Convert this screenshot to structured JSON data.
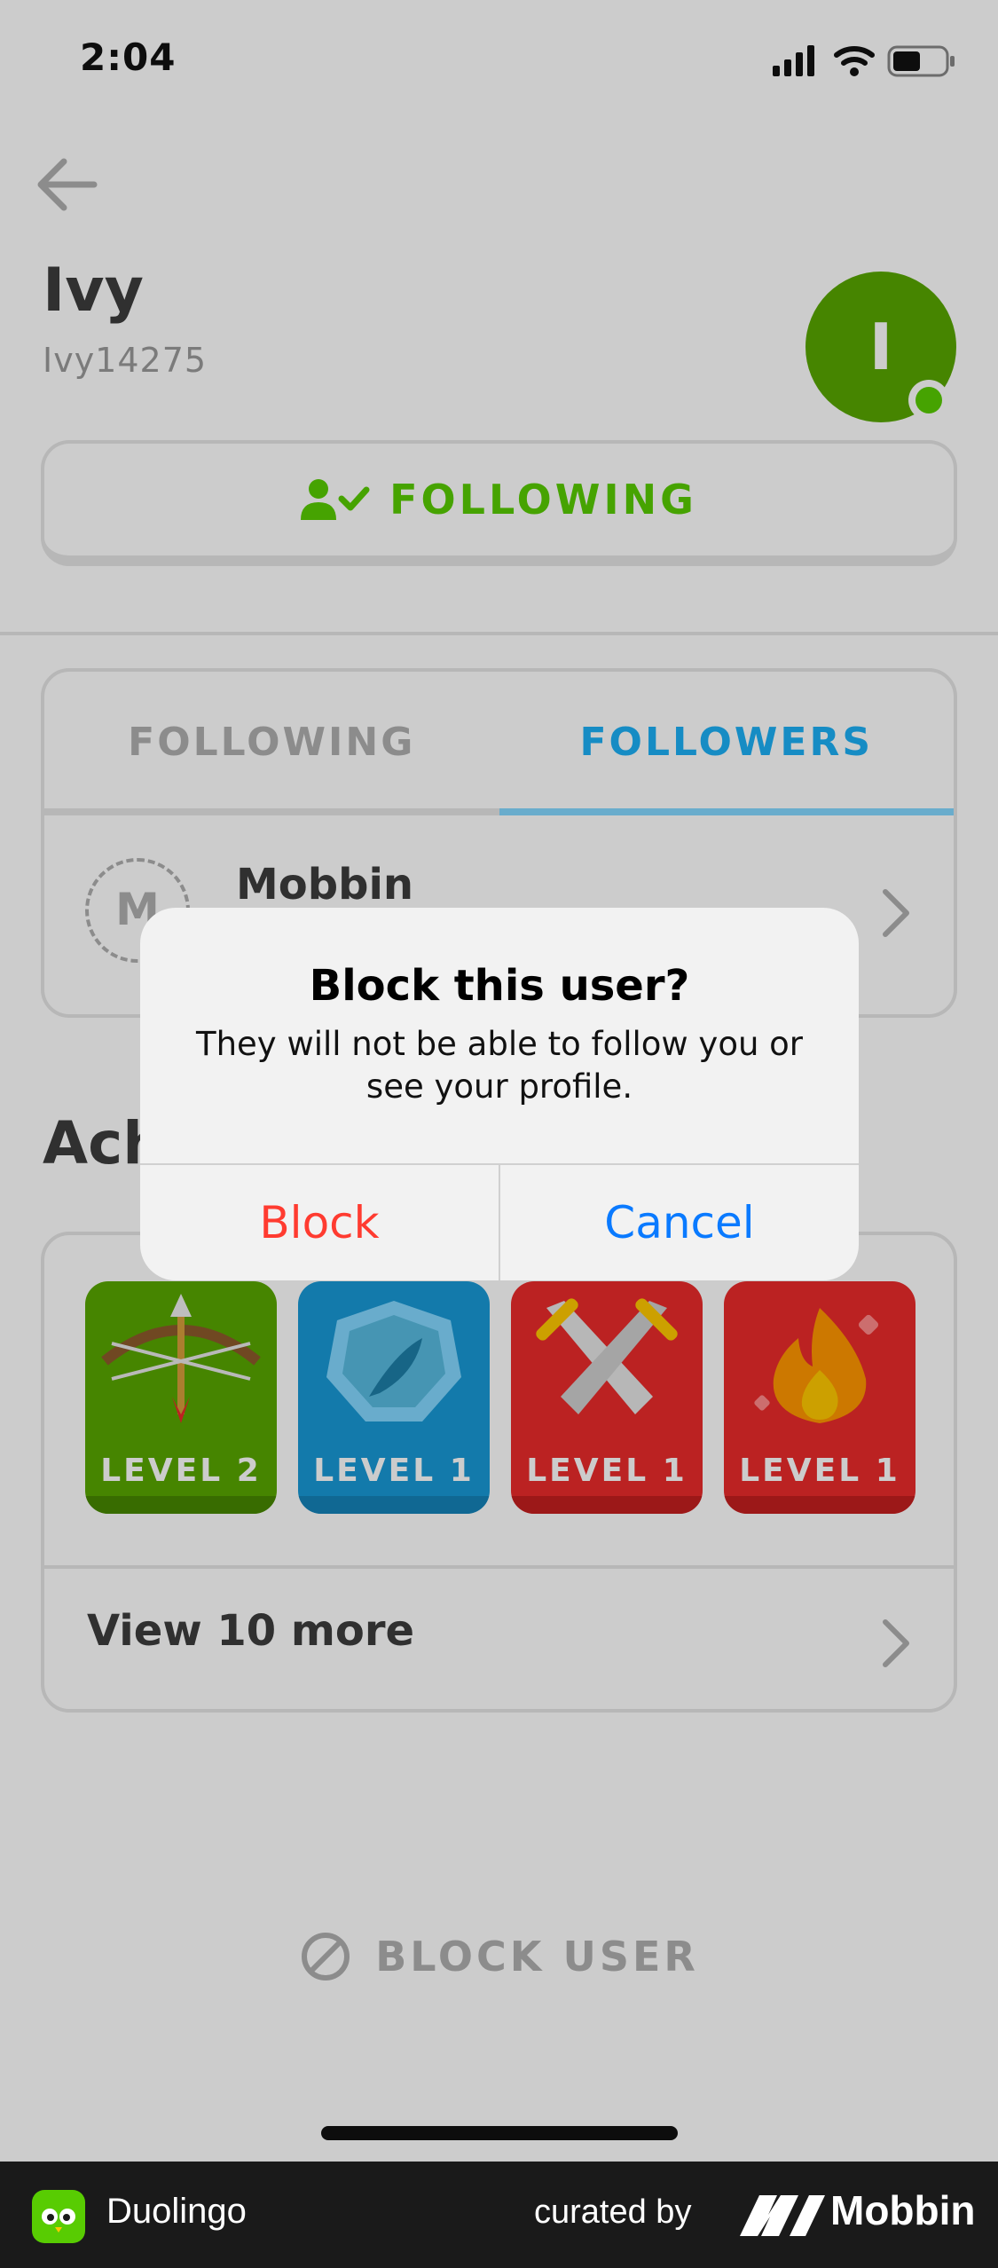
{
  "status_bar": {
    "time": "2:04"
  },
  "profile": {
    "name": "Ivy",
    "username": "Ivy14275",
    "avatar_letter": "I",
    "follow_button_label": "FOLLOWING"
  },
  "tabs": [
    {
      "label": "FOLLOWING",
      "active": false
    },
    {
      "label": "FOLLOWERS",
      "active": true
    }
  ],
  "followers": [
    {
      "avatar_letter": "M",
      "name": "Mobbin"
    }
  ],
  "achievements": {
    "title_visible": "Ach",
    "badges": [
      {
        "label": "LEVEL 2",
        "icon": "bow-arrow-icon",
        "color": "#58a700"
      },
      {
        "label": "LEVEL 1",
        "icon": "feather-icon",
        "color": "#1899d6"
      },
      {
        "label": "LEVEL 1",
        "icon": "crossed-swords-icon",
        "color": "#ea2b2b"
      },
      {
        "label": "LEVEL 1",
        "icon": "flame-icon",
        "color": "#ea2b2b"
      }
    ],
    "view_more_label": "View 10 more"
  },
  "block_user_label": "BLOCK USER",
  "alert": {
    "title": "Block this user?",
    "message": "They will not be able to follow you or see your profile.",
    "block_label": "Block",
    "cancel_label": "Cancel"
  },
  "footer": {
    "app_name": "Duolingo",
    "curated_by": "curated by",
    "brand": "Mobbin"
  },
  "colors": {
    "green": "#58cc02",
    "blue": "#1cb0f6",
    "alert_destructive": "#ff3b30",
    "alert_default": "#0a7aff"
  }
}
